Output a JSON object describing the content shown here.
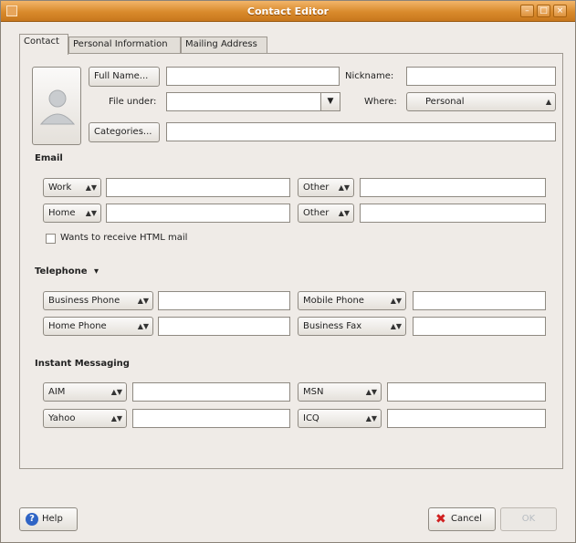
{
  "window": {
    "title": "Contact Editor"
  },
  "tabs": [
    "Contact",
    "Personal Information",
    "Mailing Address"
  ],
  "contact": {
    "full_name_button": "Full Name...",
    "nickname_label": "Nickname:",
    "file_under_label": "File under:",
    "where_label": "Where:",
    "where_value": "Personal",
    "categories_button": "Categories...",
    "full_name_value": "",
    "nickname_value": "",
    "file_under_value": "",
    "categories_value": ""
  },
  "email": {
    "heading": "Email",
    "rows": [
      {
        "left_type": "Work",
        "right_type": "Other"
      },
      {
        "left_type": "Home",
        "right_type": "Other"
      }
    ],
    "html_mail_label": "Wants to receive HTML mail"
  },
  "telephone": {
    "heading": "Telephone",
    "rows": [
      {
        "left_type": "Business Phone",
        "right_type": "Mobile Phone"
      },
      {
        "left_type": "Home Phone",
        "right_type": "Business Fax"
      }
    ]
  },
  "im": {
    "heading": "Instant Messaging",
    "rows": [
      {
        "left_type": "AIM",
        "right_type": "MSN"
      },
      {
        "left_type": "Yahoo",
        "right_type": "ICQ"
      }
    ]
  },
  "footer": {
    "help_label": "Help",
    "cancel_label": "Cancel",
    "ok_label": "OK"
  }
}
